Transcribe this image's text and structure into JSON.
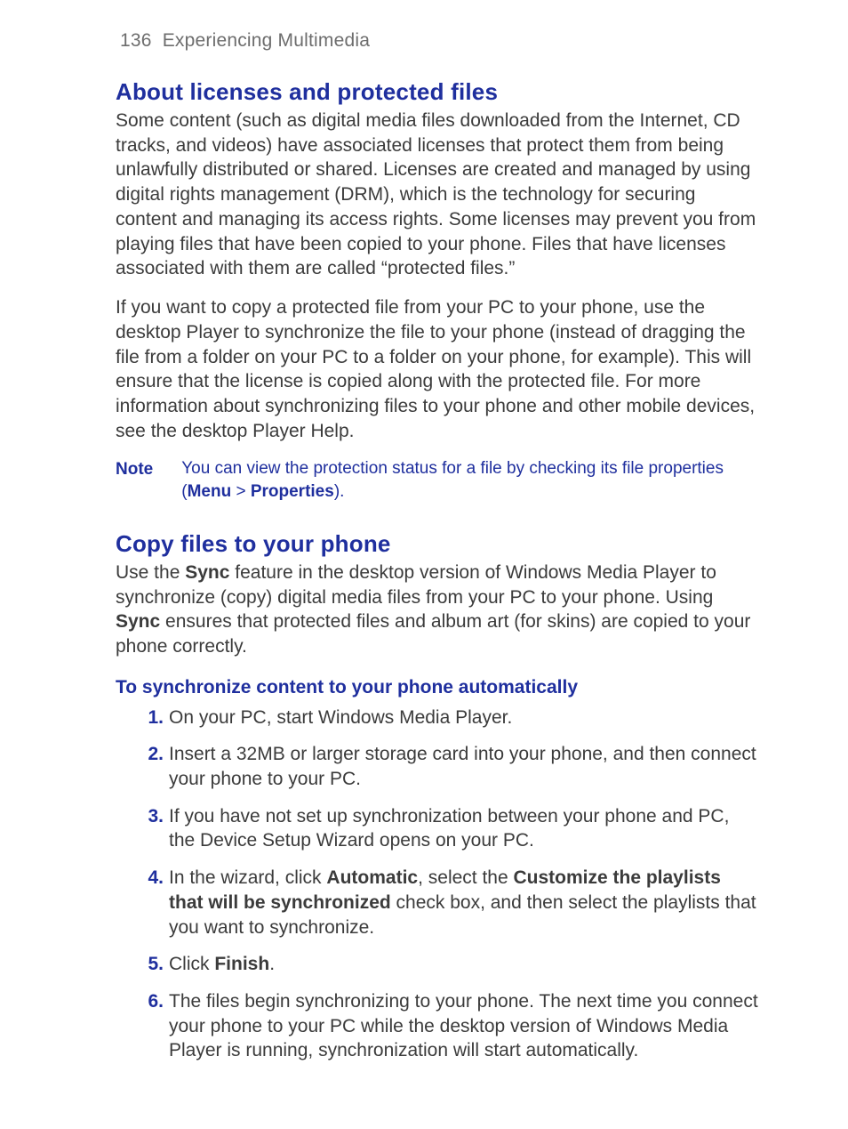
{
  "runningHead": {
    "pageNumber": "136",
    "chapter": "Experiencing Multimedia"
  },
  "section1": {
    "heading": "About licenses and protected files",
    "para1": "Some content (such as digital media files downloaded from the Internet, CD tracks, and videos) have associated licenses that protect them from being unlawfully distributed or shared. Licenses are created and managed by using digital rights management (DRM), which is the technology for securing content and managing its access rights. Some licenses may prevent you from playing files that have been copied to your phone. Files that have licenses associated with them are called “protected files.”",
    "para2": "If you want to copy a protected file from your PC to your phone, use the desktop Player to synchronize the file to your phone (instead of dragging the file from a folder on your PC to a folder on your phone, for example). This will ensure that the license is copied along with the protected file. For more information about synchronizing files to your phone and other mobile devices, see the desktop Player Help."
  },
  "note": {
    "label": "Note",
    "text_pre": "You can view the protection status for a file by checking its file properties (",
    "menu": "Menu",
    "gt": " > ",
    "properties": "Properties",
    "text_post": ")."
  },
  "section2": {
    "heading": "Copy files to your phone",
    "para_pre": "Use the ",
    "sync1": "Sync",
    "para_mid": " feature in the desktop version of Windows Media Player to synchronize (copy) digital media files from your PC to your phone. Using ",
    "sync2": "Sync",
    "para_post": " ensures that protected files and album art (for skins) are copied to your phone correctly."
  },
  "procedure": {
    "heading": "To synchronize content to your phone automatically",
    "steps": {
      "s1": "On your PC, start Windows Media Player.",
      "s2": "Insert a 32MB or larger storage card into your phone, and then connect your phone to your PC.",
      "s3": "If you have not set up synchronization between your phone and PC, the Device Setup Wizard opens on your PC.",
      "s4_pre": "In the wizard, click ",
      "s4_auto": "Automatic",
      "s4_mid1": ", select the ",
      "s4_cust": "Customize the playlists that will be synchronized",
      "s4_post": " check box, and then select the playlists that you want to synchronize.",
      "s5_pre": "Click ",
      "s5_finish": "Finish",
      "s5_post": ".",
      "s6": "The files begin synchronizing to your phone. The next time you connect your phone to your PC while the desktop version of Windows Media Player is running, synchronization will start automatically."
    }
  }
}
